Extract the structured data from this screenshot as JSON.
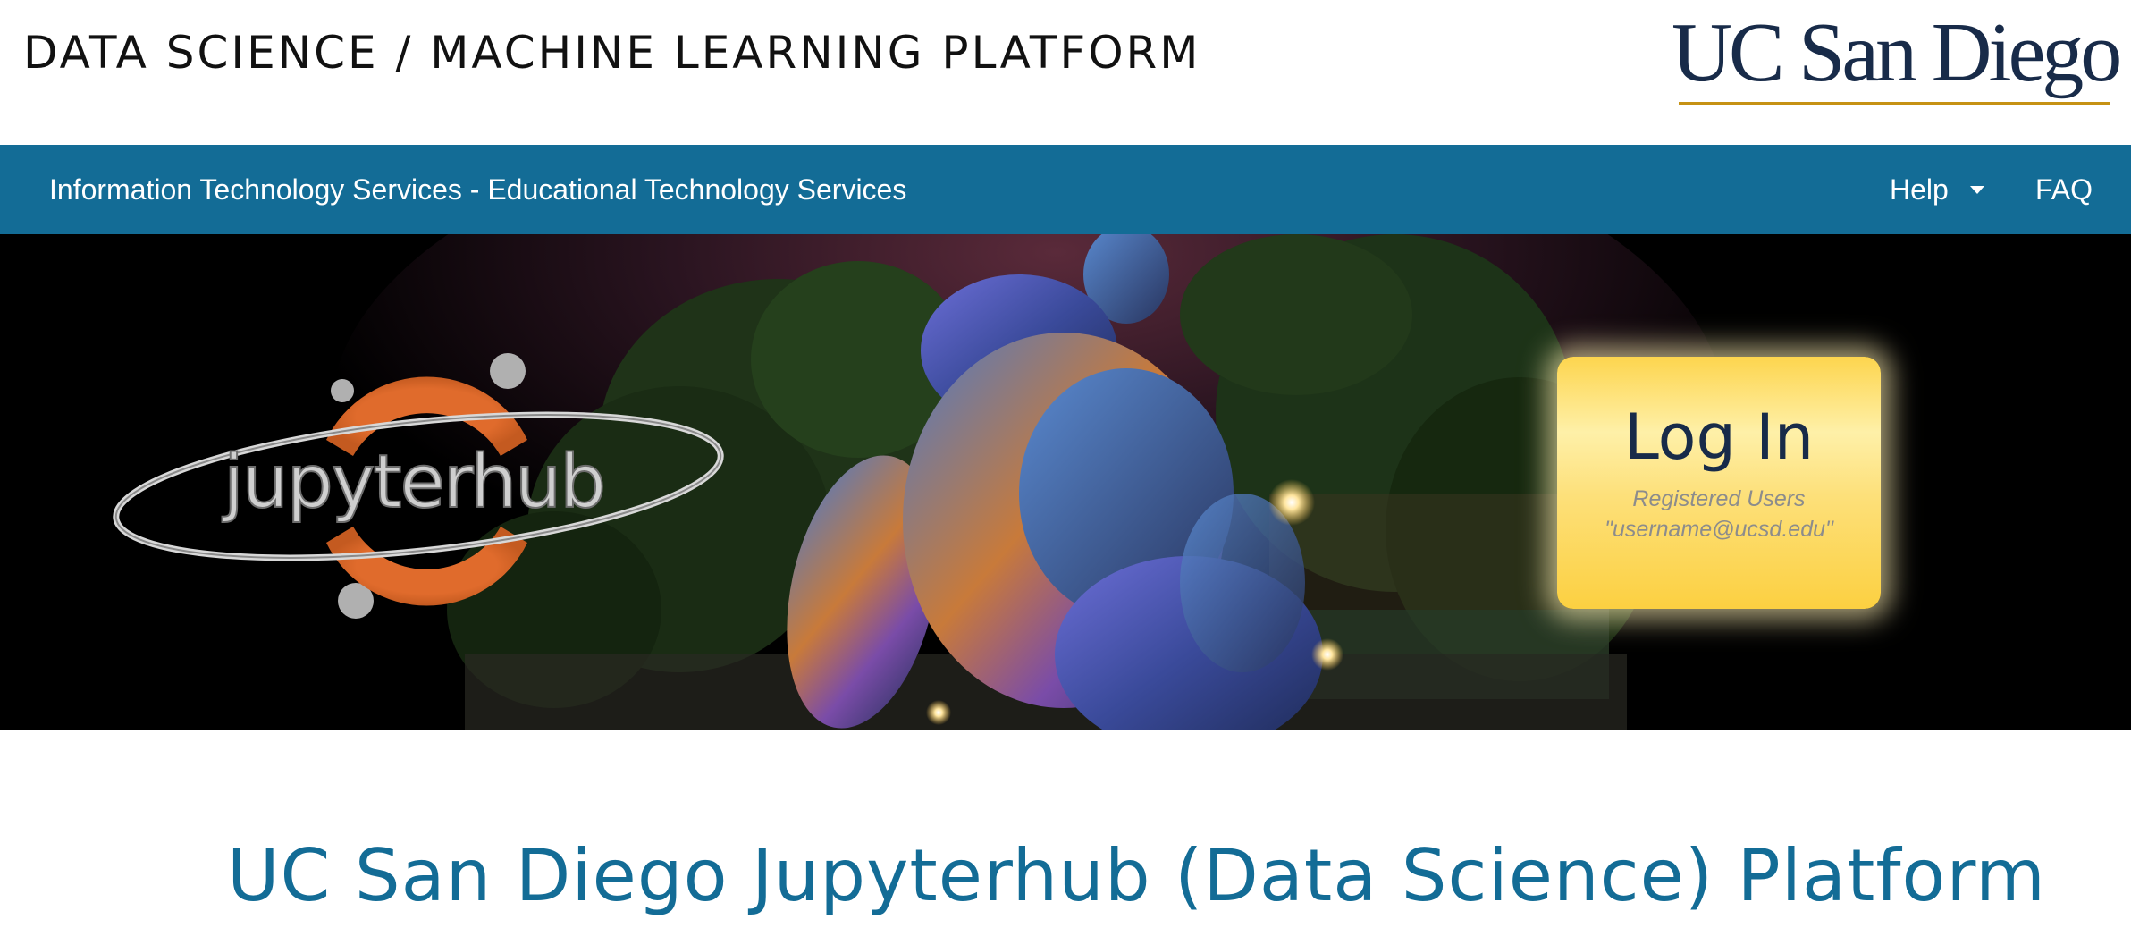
{
  "header": {
    "platform_title": "DATA SCIENCE / MACHINE LEARNING PLATFORM",
    "logo_text": "UC San Diego"
  },
  "nav": {
    "org_link": "Information Technology Services - Educational Technology Services",
    "help_label": "Help",
    "faq_label": "FAQ"
  },
  "hero": {
    "logo_text": "jupyterhub",
    "login": {
      "title": "Log In",
      "line1": "Registered Users",
      "line2": "\"username@ucsd.edu\""
    }
  },
  "main": {
    "heading": "UC San Diego Jupyterhub (Data Science) Platform"
  },
  "colors": {
    "nav_bg": "#136c96",
    "brand_navy": "#182b49",
    "brand_gold": "#c69214",
    "login_yellow": "#fdd54e",
    "jupyter_orange": "#e06b2c"
  }
}
